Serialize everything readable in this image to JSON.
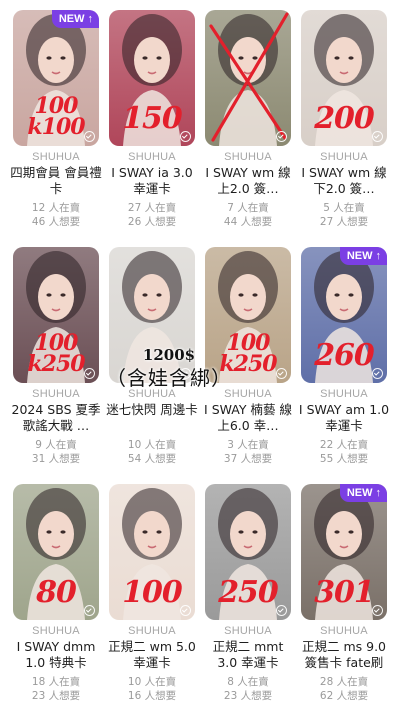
{
  "brand": "SHUHUA",
  "badge_label": "NEW",
  "cards": [
    {
      "id": "c1",
      "title": "四期會員 會員禮卡",
      "sales": "12 人在賣",
      "wants": "46 人想要",
      "price_line1": "100",
      "price_line2": "k100",
      "new": true,
      "crossed": false,
      "bg": "#c9a6a0"
    },
    {
      "id": "c2",
      "title": "I SWAY ia 3.0 幸運卡",
      "sales": "27 人在賣",
      "wants": "26 人想要",
      "price_line1": "150",
      "price_line2": "",
      "new": false,
      "crossed": false,
      "bg": "#b0465a"
    },
    {
      "id": "c3",
      "title": "I SWAY wm 線上2.0 簽…",
      "sales": "7 人在賣",
      "wants": "44 人想要",
      "price_line1": "",
      "price_line2": "",
      "new": false,
      "crossed": true,
      "bg": "#8c8a72"
    },
    {
      "id": "c4",
      "title": "I SWAY wm 線下2.0 簽…",
      "sales": "5 人在賣",
      "wants": "27 人想要",
      "price_line1": "200",
      "price_line2": "",
      "new": false,
      "crossed": false,
      "bg": "#d8cfc8"
    },
    {
      "id": "c5",
      "title": "2024 SBS 夏季歌謠大戰 …",
      "sales": "9 人在賣",
      "wants": "31 人想要",
      "price_line1": "100",
      "price_line2": "k250",
      "new": false,
      "crossed": false,
      "bg": "#6b4f55"
    },
    {
      "id": "c6",
      "title": "迷七快閃 周邊卡",
      "sales": "10 人在賣",
      "wants": "54 人想要",
      "price_line1": "",
      "price_line2": "",
      "new": false,
      "crossed": false,
      "bg": "#d9d6d2"
    },
    {
      "id": "c7",
      "title": "I SWAY 楠藝 線上6.0 幸…",
      "sales": "3 人在賣",
      "wants": "37 人想要",
      "price_line1": "100",
      "price_line2": "k250",
      "new": false,
      "crossed": false,
      "bg": "#b9a488"
    },
    {
      "id": "c8",
      "title": "I SWAY am 1.0 幸運卡",
      "sales": "22 人在賣",
      "wants": "55 人想要",
      "price_line1": "260",
      "price_line2": "",
      "new": true,
      "crossed": false,
      "bg": "#5f6fa8"
    },
    {
      "id": "c9",
      "title": "I SWAY dmm 1.0 特典卡",
      "sales": "18 人在賣",
      "wants": "23 人想要",
      "price_line1": "80",
      "price_line2": "",
      "new": false,
      "crossed": false,
      "bg": "#9fa58c"
    },
    {
      "id": "c10",
      "title": "正規二 wm 5.0 幸運卡",
      "sales": "10 人在賣",
      "wants": "16 人想要",
      "price_line1": "100",
      "price_line2": "",
      "new": false,
      "crossed": false,
      "bg": "#eadcd3"
    },
    {
      "id": "c11",
      "title": "正規二 mmt 3.0 幸運卡",
      "sales": "8 人在賣",
      "wants": "23 人想要",
      "price_line1": "250",
      "price_line2": "",
      "new": false,
      "crossed": false,
      "bg": "#9a9a9a"
    },
    {
      "id": "c12",
      "title": "正規二 ms 9.0 簽售卡 fate刷",
      "sales": "28 人在賣",
      "wants": "62 人想要",
      "price_line1": "301",
      "price_line2": "",
      "new": true,
      "crossed": false,
      "bg": "#7a7068"
    }
  ],
  "overlay": {
    "amount": "1200$",
    "includes": "（含娃含綁）"
  },
  "colors": {
    "accent": "#7b3fe4",
    "price_ink": "#e3202c",
    "muted": "#9a9a9a"
  }
}
